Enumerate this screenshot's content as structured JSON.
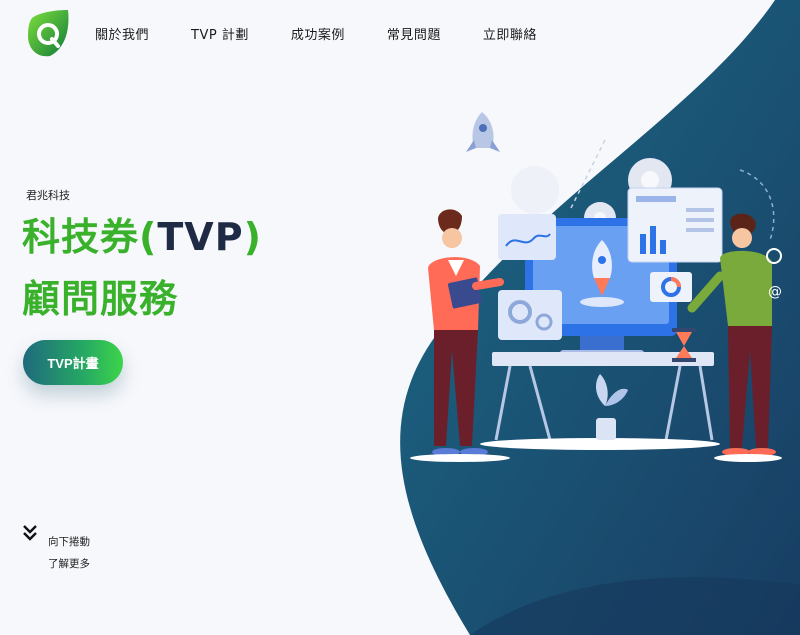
{
  "brand": {
    "logo_icon": "q-leaf-logo-icon",
    "colors": {
      "green": "#39b12b",
      "navy": "#1f4e75"
    }
  },
  "nav": {
    "items": [
      {
        "label": "關於我們"
      },
      {
        "label": "TVP 計劃"
      },
      {
        "label": "成功案例"
      },
      {
        "label": "常見問題"
      },
      {
        "label": "立即聯絡"
      }
    ]
  },
  "hero": {
    "eyebrow": "君兆科技",
    "title_line1_a": "科技券(",
    "title_line1_b": "TVP",
    "title_line1_c": ")",
    "title_line2": "顧問服務",
    "cta_label": "TVP計畫"
  },
  "scroll_hint": {
    "line1": "向下捲動",
    "line2": "了解更多",
    "icon": "double-chevron-down-icon"
  }
}
